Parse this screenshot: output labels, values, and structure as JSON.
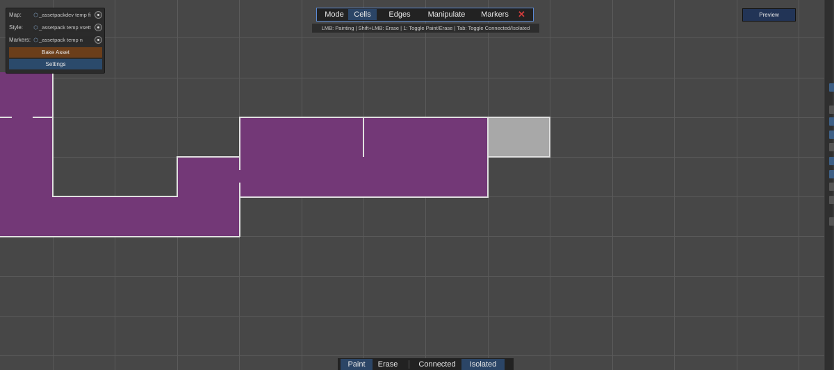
{
  "panel": {
    "map_label": "Map:",
    "map_value": "_assetpackdev temp fi",
    "style_label": "Style:",
    "style_value": "_assetpack temp vsett",
    "markers_label": "Markers:",
    "markers_value": "_assetpack temp n",
    "bake_label": "Bake Asset",
    "settings_label": "Settings"
  },
  "modebar": {
    "title": "Mode",
    "tabs": [
      "Cells",
      "Edges",
      "Manipulate",
      "Markers"
    ],
    "active_tab": "Cells",
    "close_glyph": "✕",
    "hint": "LMB: Painting | Shift+LMB: Erase | 1: Toggle Paint/Erase | Tab: Toggle Connected/Isolated"
  },
  "preview_label": "Preview",
  "paintbar": {
    "paint": "Paint",
    "erase": "Erase",
    "connected": "Connected",
    "isolated": "Isolated",
    "active": [
      "Paint",
      "Isolated"
    ]
  },
  "colors": {
    "background": "#474747",
    "cell_fill": "#733877",
    "cell_highlight": "#a8a8a8",
    "outline": "#e0e0e0",
    "accent": "#2b4566",
    "close": "#d23c3c"
  },
  "icons": {
    "asset": "cube-icon",
    "picker": "target-icon",
    "close": "close-icon"
  }
}
